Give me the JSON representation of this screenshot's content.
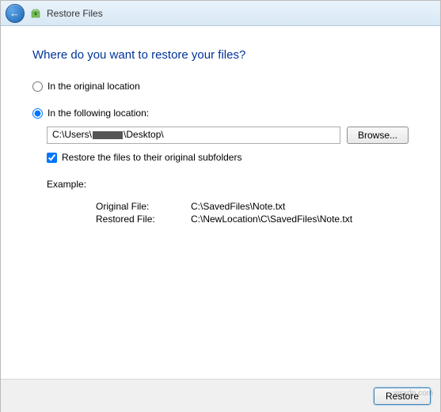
{
  "titlebar": {
    "title": "Restore Files"
  },
  "heading": "Where do you want to restore your files?",
  "options": {
    "original_location": "In the original location",
    "following_location": "In the following location:",
    "selected": "following"
  },
  "location": {
    "path_prefix": "C:\\Users\\",
    "path_suffix": "\\Desktop\\",
    "browse": "Browse..."
  },
  "subfolders": {
    "label": "Restore the files to their original subfolders",
    "checked": true
  },
  "example": {
    "label": "Example:",
    "original_label": "Original File:",
    "original_value": "C:\\SavedFiles\\Note.txt",
    "restored_label": "Restored File:",
    "restored_value": "C:\\NewLocation\\C\\SavedFiles\\Note.txt"
  },
  "footer": {
    "restore": "Restore"
  },
  "watermark": "wsxdn.com"
}
